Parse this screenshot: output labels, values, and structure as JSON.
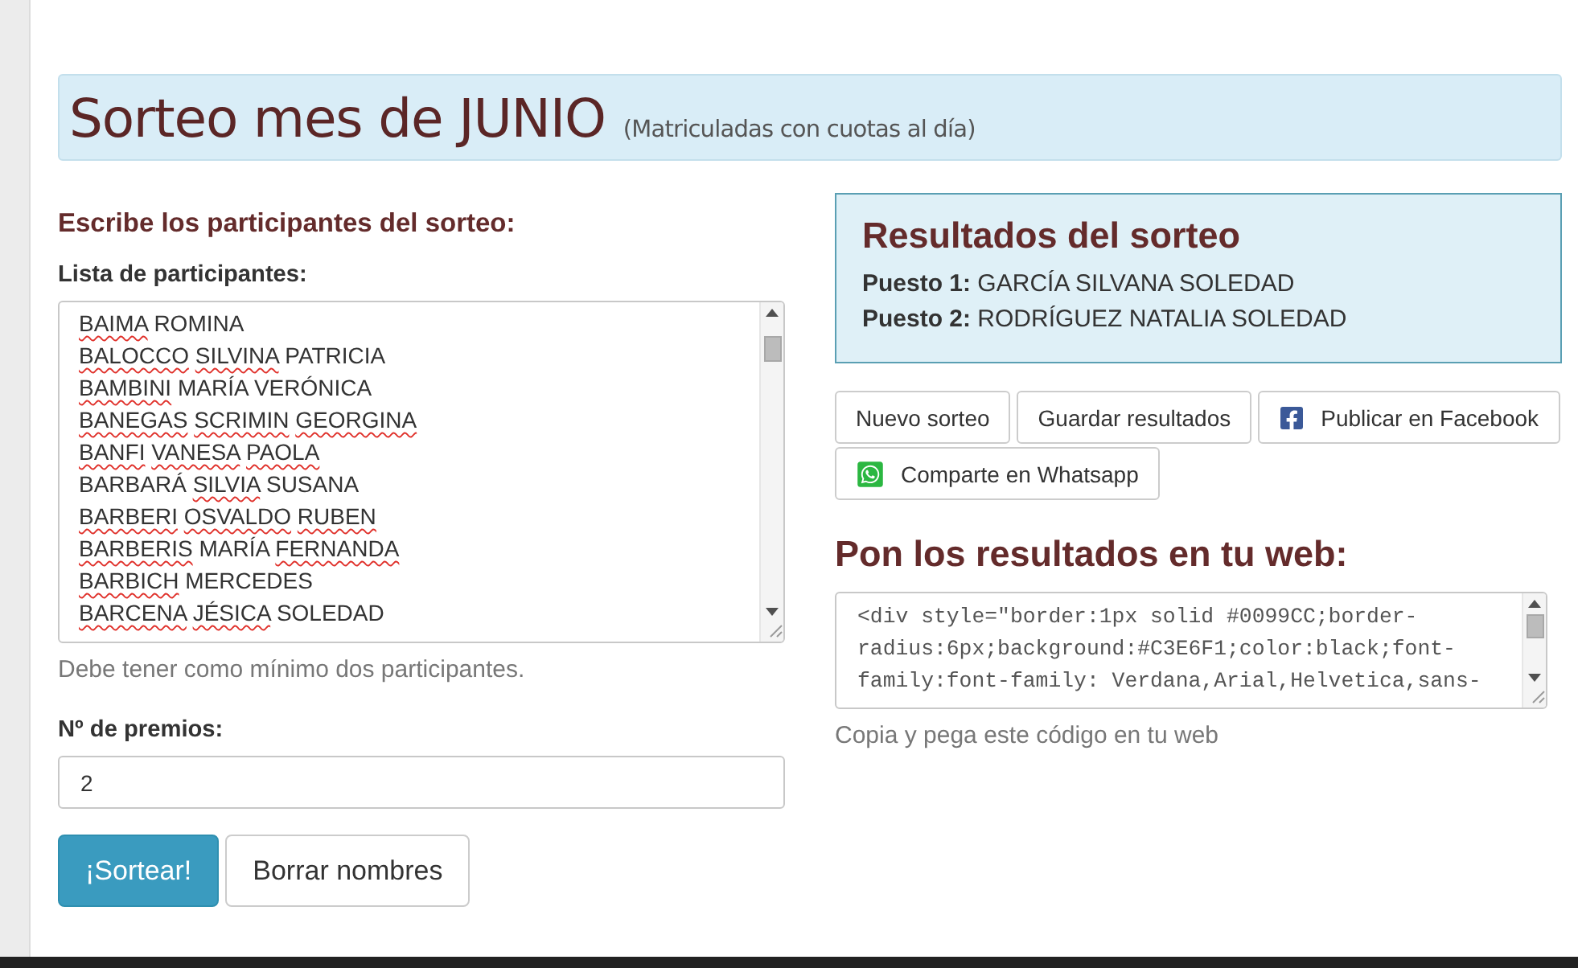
{
  "banner": {
    "title": "Sorteo mes de JUNIO",
    "subtitle": "(Matriculadas con cuotas al día)"
  },
  "entry": {
    "heading": "Escribe los participantes del sorteo:",
    "list_label": "Lista de participantes:",
    "participants": [
      {
        "name": "BAIMA ROMINA",
        "flagged_words": [
          true,
          false
        ]
      },
      {
        "name": "BALOCCO SILVINA PATRICIA",
        "flagged_words": [
          true,
          true,
          false
        ]
      },
      {
        "name": "BAMBINI MARÍA VERÓNICA",
        "flagged_words": [
          true,
          false,
          false
        ]
      },
      {
        "name": "BANEGAS SCRIMIN GEORGINA",
        "flagged_words": [
          true,
          true,
          true
        ]
      },
      {
        "name": "BANFI VANESA PAOLA",
        "flagged_words": [
          true,
          true,
          true
        ]
      },
      {
        "name": "BARBARÁ SILVIA SUSANA",
        "flagged_words": [
          false,
          true,
          false
        ]
      },
      {
        "name": "BARBERI OSVALDO RUBEN",
        "flagged_words": [
          true,
          true,
          true
        ]
      },
      {
        "name": "BARBERIS MARÍA FERNANDA",
        "flagged_words": [
          true,
          false,
          true
        ]
      },
      {
        "name": "BARBICH MERCEDES",
        "flagged_words": [
          true,
          false
        ]
      },
      {
        "name": "BARCENA JÉSICA SOLEDAD",
        "flagged_words": [
          true,
          true,
          false
        ]
      }
    ],
    "hint": "Debe tener como mínimo dos participantes.",
    "prizes_label": "Nº de premios:",
    "prizes_value": "2",
    "buttons": [
      {
        "label": "¡Sortear!",
        "kind": "primary"
      },
      {
        "label": "Borrar nombres",
        "kind": "default"
      }
    ]
  },
  "results": {
    "heading": "Resultados del sorteo",
    "places": [
      "**Puesto 1:** GARCÍA SILVANA SOLEDAD",
      "**Puesto 2:** RODRÍGUEZ NATALIA SOLEDAD"
    ],
    "buttons": [
      {
        "label": "Nuevo sorteo",
        "kind": "plain"
      },
      {
        "label": "Guardar resultados",
        "kind": "plain"
      },
      {
        "label": "Publicar en Facebook",
        "kind": "facebook"
      },
      {
        "label": "Comparte en Whatsapp",
        "kind": "whatsapp"
      }
    ]
  },
  "embed": {
    "heading": "Pon los resultados en tu web:",
    "code_lines": [
      "<div style=\"border:1px solid #0099CC;border-",
      "radius:6px;background:#C3E6F1;color:black;font-",
      "family:font-family: Verdana,Arial,Helvetica,sans-"
    ],
    "hint": "Copia y pega este código en tu web"
  }
}
